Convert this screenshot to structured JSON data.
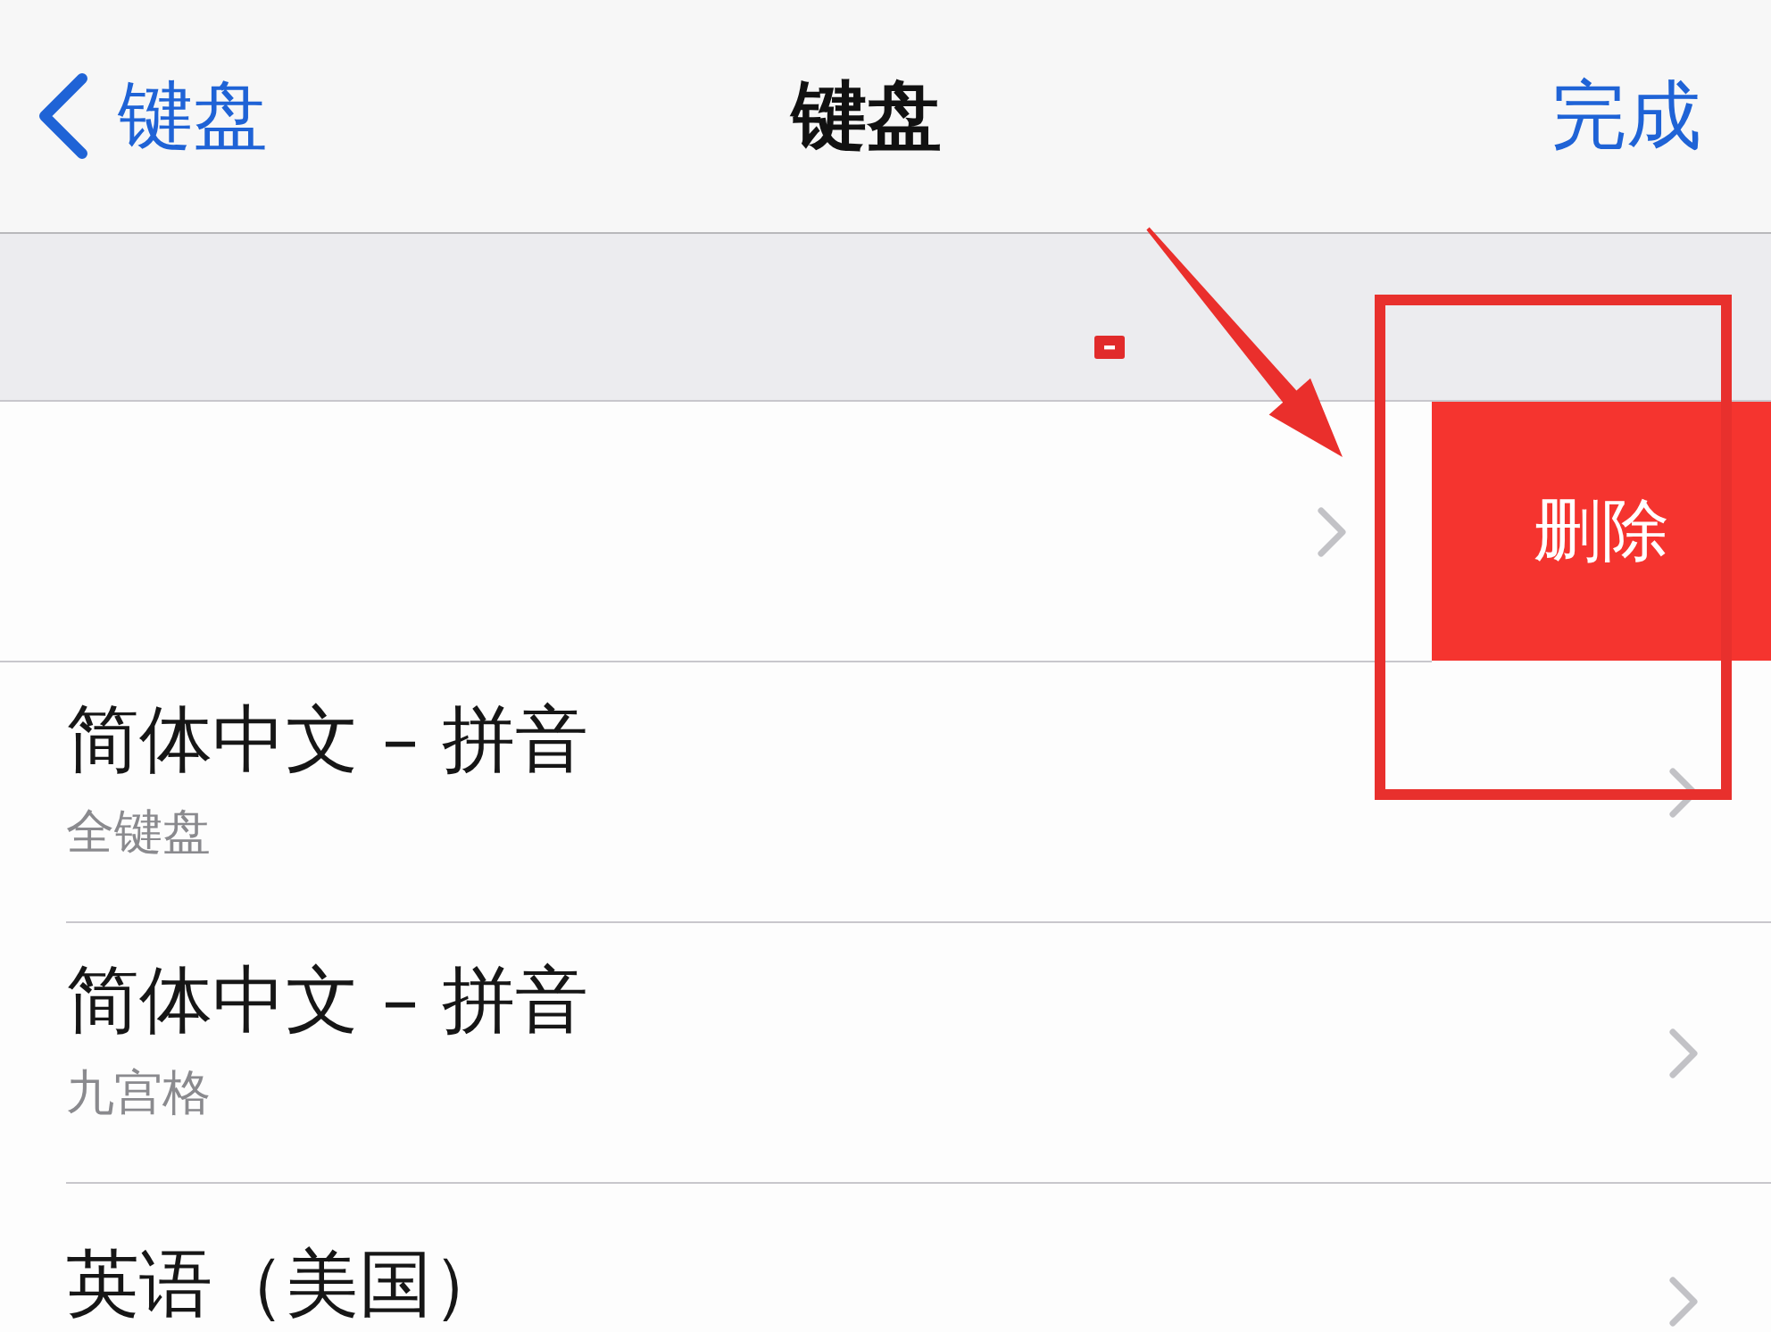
{
  "nav_bar": {
    "back_label": "键盘",
    "title": "键盘",
    "done": "完成"
  },
  "keyboards": [
    {
      "swiped": true,
      "action": "删除"
    },
    {
      "title": "简体中文 – 拼音",
      "subtitle": "全键盘",
      "swiped": false
    },
    {
      "title": "简体中文 – 拼音",
      "subtitle": "九宫格",
      "swiped": false
    },
    {
      "title": "英语（美国）",
      "swiped": false
    }
  ],
  "annotations": [
    {
      "kind": "tag"
    },
    {
      "kind": "arrow"
    },
    {
      "kind": "frame"
    }
  ]
}
